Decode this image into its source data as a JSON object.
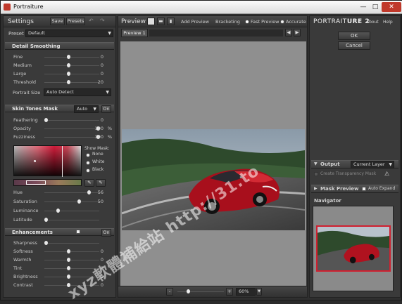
{
  "window": {
    "title": "Portraiture",
    "min": "—",
    "max": "□",
    "close": "✕"
  },
  "settings": {
    "title": "Settings",
    "save": "Save",
    "presets": "Presets",
    "preset_label": "Preset",
    "preset_value": "Default",
    "detail": {
      "title": "Detail Smoothing",
      "rows": [
        {
          "label": "Fine",
          "value": "0",
          "pos": 0.42
        },
        {
          "label": "Medium",
          "value": "0",
          "pos": 0.42
        },
        {
          "label": "Large",
          "value": "0",
          "pos": 0.42
        },
        {
          "label": "Threshold",
          "value": "20",
          "pos": 0.42
        }
      ],
      "portrait_size_label": "Portrait Size",
      "portrait_size_value": "Auto Detect"
    },
    "skin": {
      "title": "Skin Tones Mask",
      "mode": "Auto",
      "toggle": "On",
      "rows": [
        {
          "label": "Feathering",
          "value": "0",
          "unit": "",
          "pos": 0.0
        },
        {
          "label": "Opacity",
          "value": "100",
          "unit": "%",
          "pos": 0.97
        },
        {
          "label": "Fuzziness",
          "value": "100",
          "unit": "%",
          "pos": 0.97
        }
      ],
      "show_mask": "Show Mask:",
      "mask_options": [
        "None",
        "White",
        "Black"
      ],
      "hsl": [
        {
          "label": "Hue",
          "value": "56",
          "pos": 0.8
        },
        {
          "label": "Saturation",
          "value": "50",
          "pos": 0.62
        },
        {
          "label": "Luminance",
          "value": "",
          "pos": 0.22
        },
        {
          "label": "Latitude",
          "value": "",
          "pos": 0.0
        }
      ]
    },
    "enh": {
      "title": "Enhancements",
      "toggle": "On",
      "rows": [
        {
          "label": "Sharpness",
          "value": "",
          "pos": 0.0
        },
        {
          "label": "Softness",
          "value": "0",
          "pos": 0.42
        },
        {
          "label": "Warmth",
          "value": "0",
          "pos": 0.42
        },
        {
          "label": "Tint",
          "value": "0",
          "pos": 0.42
        },
        {
          "label": "Brightness",
          "value": "0",
          "pos": 0.42
        },
        {
          "label": "Contrast",
          "value": "0",
          "pos": 0.42
        }
      ]
    }
  },
  "preview": {
    "title": "Preview",
    "add_preview": "Add Preview",
    "bracketing": "Bracketing",
    "fast_preview": "Fast Preview",
    "accurate": "Accurate",
    "tab": "Preview 1",
    "zoom_minus": "-",
    "zoom_plus": "+",
    "zoom_value": "60%"
  },
  "right": {
    "brand_a": "PORTRAIT",
    "brand_b": "URE 2",
    "about": "About",
    "help": "Help",
    "ok": "OK",
    "cancel": "Cancel",
    "output": "Output",
    "output_value": "Current Layer",
    "create_mask": "Create Transparency Mask",
    "mask_preview": "Mask Preview",
    "auto_expand": "Auto Expand",
    "navigator": "Navigator"
  },
  "watermark": {
    "text": "xyz軟體補給站 http://31.to"
  },
  "colors": {
    "accent": "#c0392b",
    "panel": "#3a3a3a"
  }
}
